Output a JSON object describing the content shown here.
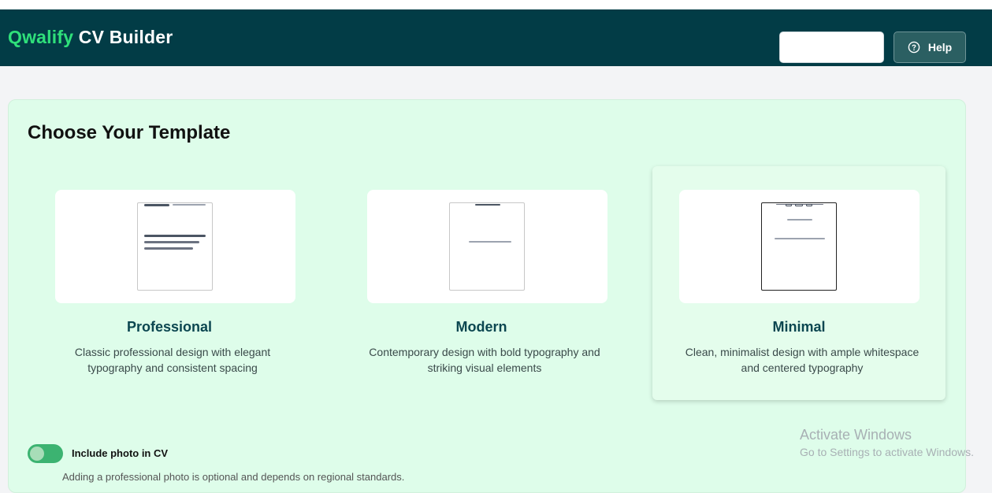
{
  "header": {
    "brand_accent": "Qwalify",
    "brand_rest": "CV Builder",
    "search_value": "",
    "help_label": "Help"
  },
  "panel": {
    "title": "Choose Your Template"
  },
  "templates": [
    {
      "name": "Professional",
      "description_line1": "Classic professional design with elegant",
      "description_line2": "typography and consistent spacing",
      "selected": false
    },
    {
      "name": "Modern",
      "description_line1": "Contemporary design with bold typography and",
      "description_line2": "striking visual elements",
      "selected": false
    },
    {
      "name": "Minimal",
      "description_line1": "Clean, minimalist design with ample whitespace",
      "description_line2": "and centered typography",
      "selected": true
    }
  ],
  "photo_option": {
    "label": "Include photo in CV",
    "enabled": true,
    "help_text": "Adding a professional photo is optional and depends on regional standards."
  },
  "watermark": {
    "line1": "Activate Windows",
    "line2": "Go to Settings to activate Windows."
  },
  "colors": {
    "header_bg": "#023c46",
    "brand_accent": "#2fe07a",
    "panel_bg": "#defdea",
    "toggle_on": "#3cb371"
  },
  "icons": {
    "help": "question-circle-icon"
  }
}
